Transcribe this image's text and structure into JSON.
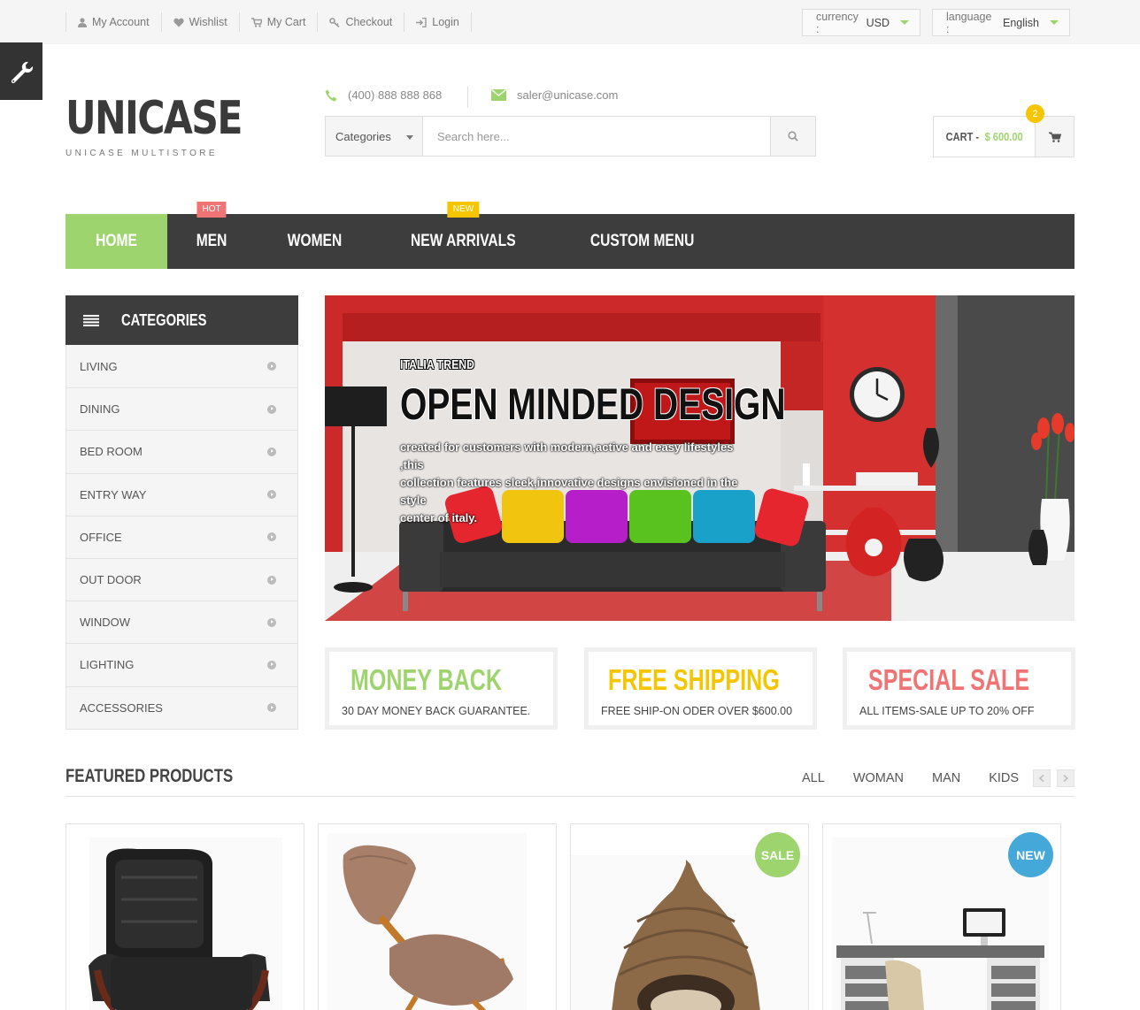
{
  "topbar": {
    "links": [
      {
        "label": "My Account",
        "icon": "user-icon"
      },
      {
        "label": "Wishlist",
        "icon": "heart-icon"
      },
      {
        "label": "My Cart",
        "icon": "cart-icon"
      },
      {
        "label": "Checkout",
        "icon": "key-icon"
      },
      {
        "label": "Login",
        "icon": "login-icon"
      }
    ],
    "currency_label": "currency :",
    "currency_value": "USD",
    "language_label": "language :",
    "language_value": "English"
  },
  "header": {
    "logo": "UNICASE",
    "tagline": "UNICASE MULTISTORE",
    "phone": "(400) 888 888 868",
    "email": "saler@unicase.com",
    "search_category": "Categories",
    "search_placeholder": "Search here...",
    "cart_label": "CART -",
    "cart_amount": "$ 600.00",
    "cart_count": "2"
  },
  "nav": {
    "items": [
      {
        "label": "HOME"
      },
      {
        "label": "MEN",
        "badge": "HOT"
      },
      {
        "label": "WOMEN"
      },
      {
        "label": "NEW ARRIVALS",
        "badge": "NEW"
      },
      {
        "label": "CUSTOM MENU"
      }
    ]
  },
  "sidebar": {
    "title": "CATEGORIES",
    "items": [
      "LIVING",
      "DINING",
      "BED ROOM",
      "ENTRY WAY",
      "OFFICE",
      "OUT DOOR",
      "WINDOW",
      "LIGHTING",
      "ACCESSORIES"
    ]
  },
  "hero": {
    "kicker": "ITALIA TREND",
    "title": "OPEN MINDED DESIGN",
    "desc_line1": "created for customers with modern,active and easy lifestyles ,this",
    "desc_line2": "collection features sleek,innovative designs envisioned in the style",
    "desc_line3": "center of italy."
  },
  "info": [
    {
      "title": "MONEY BACK",
      "desc": "30 DAY MONEY BACK GUARANTEE.",
      "color": "#9ed46d",
      "icon": "dollar-icon"
    },
    {
      "title": "FREE SHIPPING",
      "desc": "FREE SHIP-ON ODER OVER $600.00",
      "color": "#f5c600",
      "icon": "truck-icon"
    },
    {
      "title": "SPECIAL SALE",
      "desc": "ALL ITEMS-SALE UP TO 20% OFF",
      "color": "#f07474",
      "icon": "gift-icon"
    }
  ],
  "featured": {
    "title": "FEATURED PRODUCTS",
    "tabs": [
      "ALL",
      "WOMAN",
      "MAN",
      "KIDS"
    ],
    "badges": {
      "sale": "SALE",
      "new": "NEW"
    }
  },
  "colors": {
    "accent_green": "#9ed46d",
    "accent_yellow": "#f5c600",
    "accent_red": "#f07474",
    "accent_blue": "#44a8d8",
    "dark": "#3d3d3d"
  }
}
